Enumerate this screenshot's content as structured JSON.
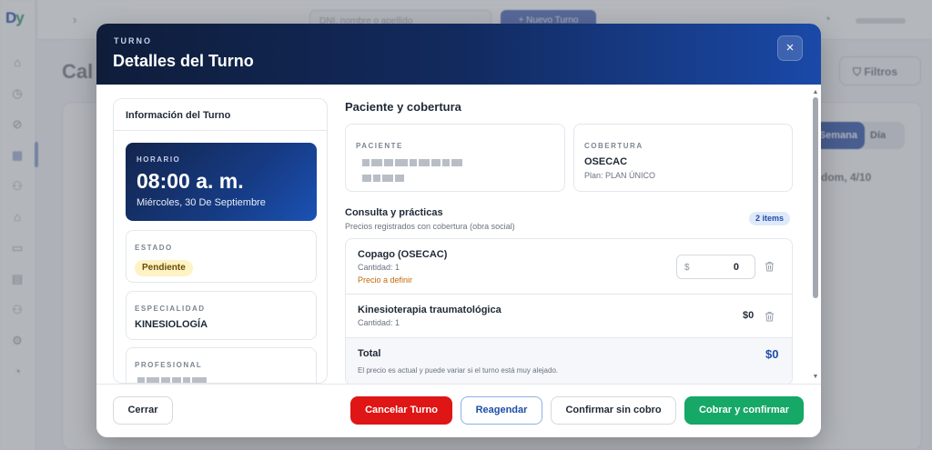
{
  "background": {
    "logo": "D",
    "logo_accent": "y",
    "search_placeholder": "DNI, nombre o apellido",
    "new_button": "+ Nuevo Turno",
    "page_title": "Cal",
    "filters_button": "Filtros",
    "view_week": "Semana",
    "view_day": "Día",
    "week_label": "dom, 4/10"
  },
  "modal": {
    "eyebrow": "TURNO",
    "title": "Detalles del Turno",
    "close_icon": "×",
    "info_panel": {
      "title": "Información del Turno",
      "schedule_label": "HORARIO",
      "time": "08:00 a. m.",
      "date": "Miércoles, 30 De Septiembre",
      "status_label": "ESTADO",
      "status_value": "Pendiente",
      "specialty_label": "ESPECIALIDAD",
      "specialty_value": "KINESIOLOGÍA",
      "professional_label": "PROFESIONAL"
    },
    "patient_section": {
      "title": "Paciente y cobertura",
      "patient_label": "PACIENTE",
      "coverage_label": "COBERTURA",
      "coverage_value": "OSECAC",
      "coverage_plan": "Plan: PLAN ÚNICO"
    },
    "practices_section": {
      "title": "Consulta y prácticas",
      "subtitle": "Precios registrados con cobertura (obra social)",
      "items_badge": "2 items",
      "items": [
        {
          "name": "Copago (OSECAC)",
          "quantity": "Cantidad: 1",
          "warning": "Precio a definir",
          "currency": "$",
          "price_input": "0"
        },
        {
          "name": "Kinesioterapia traumatológica",
          "quantity": "Cantidad: 1",
          "price": "$0"
        }
      ],
      "total_label": "Total",
      "total_value": "$0",
      "total_note": "El precio es actual y puede variar si el turno está muy alejado."
    },
    "footer": {
      "close": "Cerrar",
      "cancel": "Cancelar Turno",
      "reschedule": "Reagendar",
      "confirm_no_charge": "Confirmar sin cobro",
      "charge_confirm": "Cobrar y confirmar"
    }
  },
  "icons": {
    "trash": "trash-icon",
    "close": "close-icon",
    "scroll_up": "▲",
    "scroll_down": "▼"
  },
  "colors": {
    "header_dark": "#0f1d3a",
    "header_blue": "#1a49a8",
    "danger": "#e01515",
    "success": "#16a866",
    "accent": "#1d4ea8",
    "pending_bg": "#fdf3c4"
  }
}
